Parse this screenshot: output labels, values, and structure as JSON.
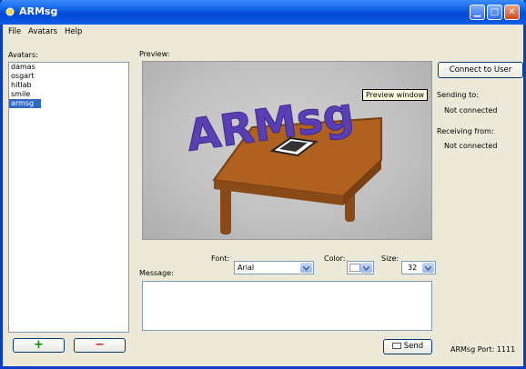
{
  "window": {
    "title": "ARMsg"
  },
  "menu": [
    "File",
    "Avatars",
    "Help"
  ],
  "avatars": {
    "label": "Avatars:",
    "items": [
      "damas",
      "osgart",
      "hitlab",
      "smile",
      "armsg"
    ],
    "selected_index": 4,
    "add_label": "+",
    "remove_label": "−"
  },
  "preview": {
    "label": "Preview:",
    "tooltip": "Preview window",
    "scene_text": "ARMsg"
  },
  "message": {
    "label": "Message:",
    "font_label": "Font:",
    "font_value": "Arial",
    "color_label": "Color:",
    "size_label": "Size:",
    "size_value": "32",
    "send_label": "Send"
  },
  "connection": {
    "button_label": "Connect to User",
    "sending_label": "Sending to:",
    "sending_value": "Not connected",
    "receiving_label": "Receiving from:",
    "receiving_value": "Not connected",
    "port_text": "ARMsg Port: 1111"
  },
  "colors": {
    "titlebar": "#0a5be0",
    "selection": "#316ac5",
    "chrome": "#ece9d8",
    "text_3d": "#5a3fb4",
    "table_wood": "#a0551c"
  },
  "icons": [
    "app-icon",
    "minimize-icon",
    "maximize-icon",
    "close-icon",
    "chevron-down-icon",
    "send-icon"
  ]
}
